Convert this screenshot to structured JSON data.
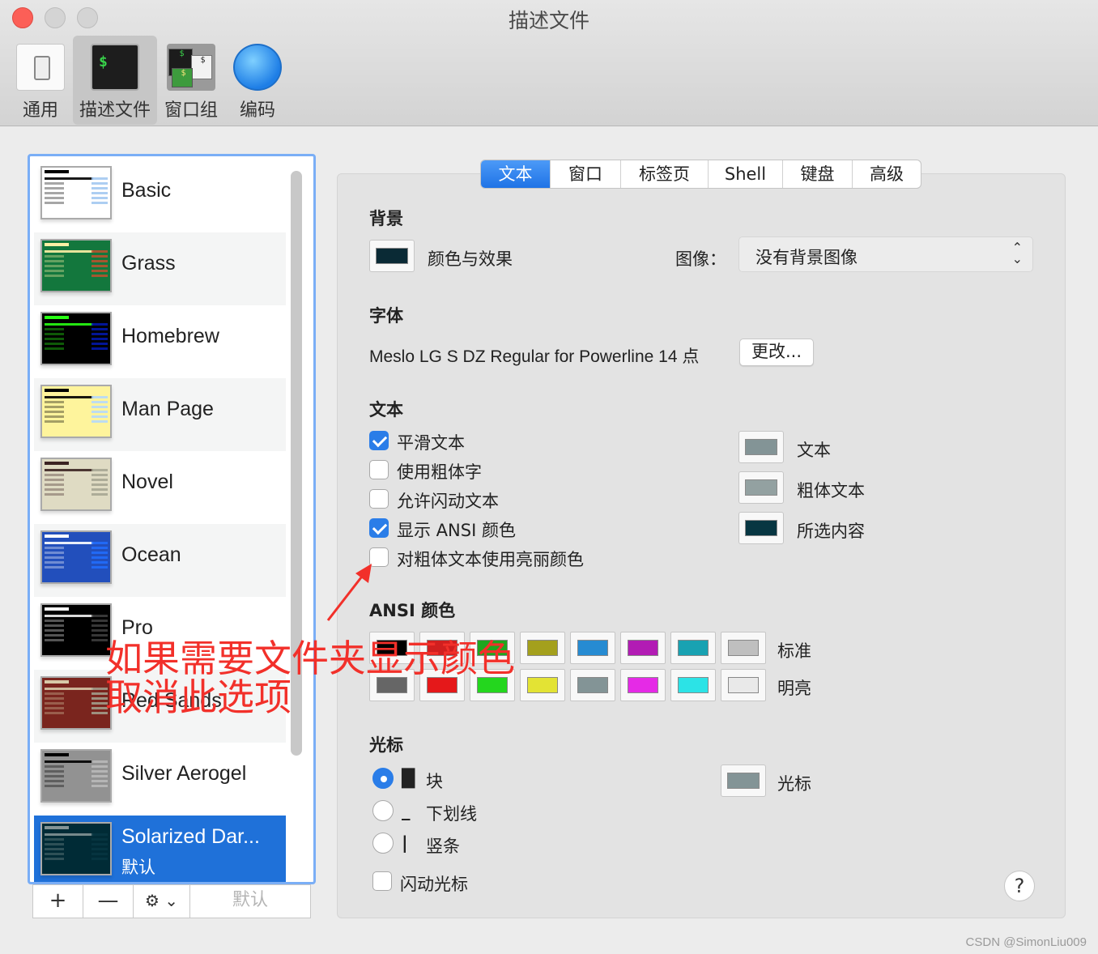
{
  "window": {
    "title": "描述文件"
  },
  "toolbar": {
    "items": [
      {
        "label": "通用",
        "icon": "switch-icon"
      },
      {
        "label": "描述文件",
        "icon": "terminal-icon"
      },
      {
        "label": "窗口组",
        "icon": "window-group-icon"
      },
      {
        "label": "编码",
        "icon": "globe-icon"
      }
    ],
    "terminal_prompt": "$",
    "winset_texts": [
      "$",
      "$",
      "$"
    ]
  },
  "profiles": [
    {
      "name": "Basic",
      "bg": "#ffffff",
      "fg": "#000000",
      "hl": "#9fc6f0"
    },
    {
      "name": "Grass",
      "bg": "#13773d",
      "fg": "#fff0a5",
      "hl": "#c0512e"
    },
    {
      "name": "Homebrew",
      "bg": "#000000",
      "fg": "#28fe14",
      "hl": "#0219b2"
    },
    {
      "name": "Man Page",
      "bg": "#fef49c",
      "fg": "#000000",
      "hl": "#b2d7ff"
    },
    {
      "name": "Novel",
      "bg": "#dfdbc3",
      "fg": "#3b2322",
      "hl": "#a4a390"
    },
    {
      "name": "Ocean",
      "bg": "#224fbc",
      "fg": "#ffffff",
      "hl": "#216dff"
    },
    {
      "name": "Pro",
      "bg": "#000000",
      "fg": "#f2f2f2",
      "hl": "#414141"
    },
    {
      "name": "Red Sands",
      "bg": "#7a251e",
      "fg": "#d7c9a7",
      "hl": "#a4a390"
    },
    {
      "name": "Silver Aerogel",
      "bg": "#929292",
      "fg": "#000000",
      "hl": "#bbbbbb"
    },
    {
      "name": "Solarized Dar...",
      "sub": "默认",
      "bg": "#002b36",
      "fg": "#839496",
      "hl": "#073642",
      "selected": true
    }
  ],
  "list_buttons": {
    "add": "+",
    "remove": "—",
    "gear": "⚙ ⌄",
    "default": "默认"
  },
  "tabs": [
    {
      "label": "文本",
      "active": true
    },
    {
      "label": "窗口"
    },
    {
      "label": "标签页"
    },
    {
      "label": "Shell"
    },
    {
      "label": "键盘"
    },
    {
      "label": "高级"
    }
  ],
  "background": {
    "title": "背景",
    "color_effects": "颜色与效果",
    "swatch": "#0a2a35",
    "image_label": "图像：",
    "image_value": "没有背景图像"
  },
  "font": {
    "title": "字体",
    "value": "Meslo LG S DZ Regular for Powerline 14 点",
    "change": "更改..."
  },
  "text_section": {
    "title": "文本",
    "options": [
      {
        "label": "平滑文本",
        "checked": true
      },
      {
        "label": "使用粗体字",
        "checked": false
      },
      {
        "label": "允许闪动文本",
        "checked": false
      },
      {
        "label": "显示 ANSI 颜色",
        "checked": true
      },
      {
        "label": "对粗体文本使用亮丽颜色",
        "checked": false
      }
    ],
    "colors": [
      {
        "label": "文本",
        "color": "#839496"
      },
      {
        "label": "粗体文本",
        "color": "#93a1a1"
      },
      {
        "label": "所选内容",
        "color": "#073642"
      }
    ]
  },
  "ansi": {
    "title": "ANSI 颜色",
    "normal_label": "标准",
    "bright_label": "明亮",
    "normal": [
      "#000000",
      "#d11f1f",
      "#1fa61f",
      "#a4a01d",
      "#268bd2",
      "#b21cb4",
      "#19a2b2",
      "#bfbfbf"
    ],
    "bright": [
      "#666666",
      "#e5181a",
      "#24d61e",
      "#e3e334",
      "#839496",
      "#e52ae6",
      "#2ce3e6",
      "#e9e9e9"
    ]
  },
  "cursor": {
    "title": "光标",
    "options": [
      {
        "label": "块",
        "glyph": "█",
        "checked": true
      },
      {
        "label": "下划线",
        "glyph": "_",
        "checked": false
      },
      {
        "label": "竖条",
        "glyph": "|",
        "checked": false
      }
    ],
    "blink": "闪动光标",
    "color_label": "光标",
    "color": "#839496"
  },
  "help": "?",
  "annotation": {
    "line1": "如果需要文件夹显示颜色",
    "line2": "取消此选项"
  },
  "watermark": "CSDN @SimonLiu009"
}
